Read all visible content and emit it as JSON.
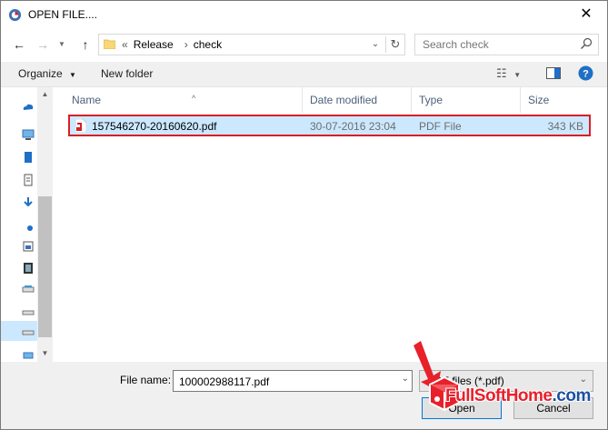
{
  "window": {
    "title": "OPEN FILE...."
  },
  "address": {
    "prefix": "«",
    "crumbs": [
      "Release",
      "check"
    ]
  },
  "search": {
    "placeholder": "Search check"
  },
  "toolbar": {
    "organize": "Organize",
    "new_folder": "New folder"
  },
  "columns": [
    "Name",
    "Date modified",
    "Type",
    "Size"
  ],
  "files": [
    {
      "name": "157546270-20160620.pdf",
      "date": "30-07-2016 23:04",
      "type": "PDF File",
      "size": "343 KB"
    }
  ],
  "bottom": {
    "file_name_label": "File name:",
    "file_name_value": "100002988117.pdf",
    "file_type": "PDF files (*.pdf)",
    "open_label": "Open",
    "cancel_label": "Cancel"
  },
  "watermark": {
    "text_red": "FullSoftHome",
    "text_blue": ".com"
  },
  "colors": {
    "selection": "#cce8ff",
    "highlight_border": "#d71f26",
    "accent": "#0078d7"
  }
}
